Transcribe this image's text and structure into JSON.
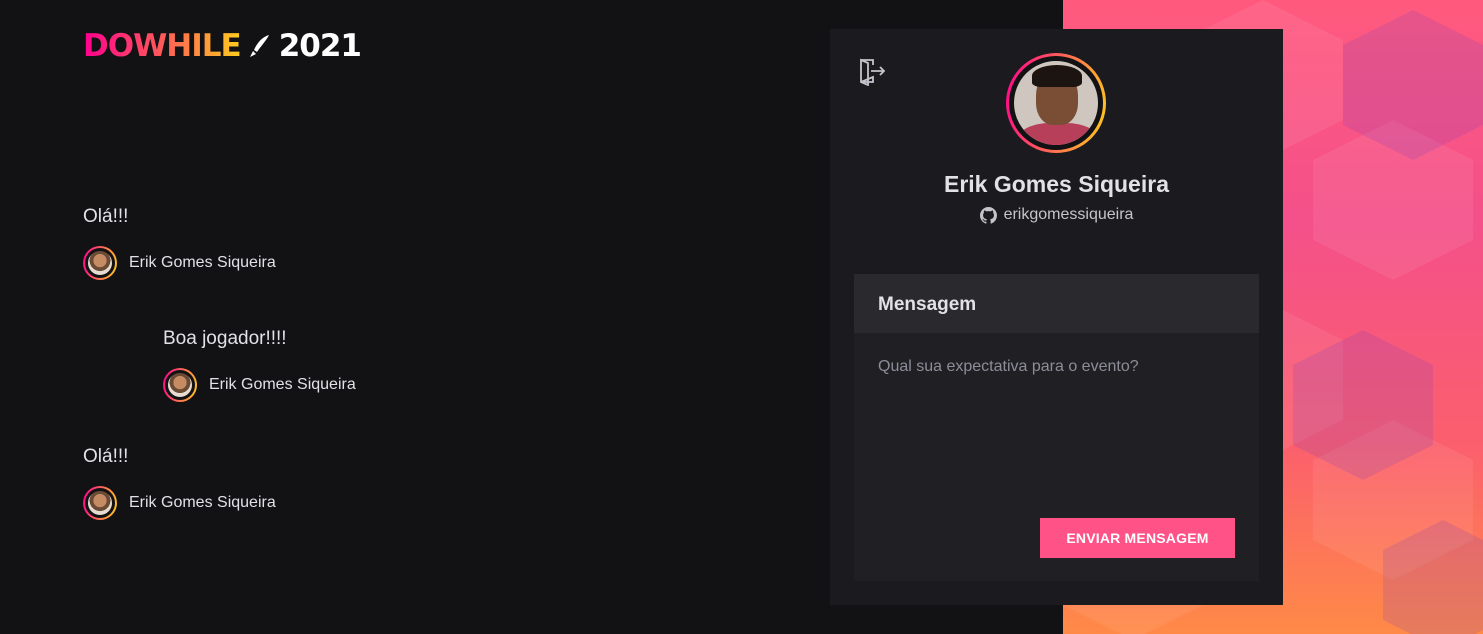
{
  "brand": {
    "logo_text": "DOWHILE",
    "logo_year": "2021"
  },
  "messages": [
    {
      "text": "Olá!!!",
      "user": "Erik Gomes Siqueira"
    },
    {
      "text": "Boa jogador!!!!",
      "user": "Erik Gomes Siqueira"
    },
    {
      "text": "Olá!!!",
      "user": "Erik Gomes Siqueira"
    }
  ],
  "profile": {
    "name": "Erik Gomes Siqueira",
    "github_username": "erikgomessiqueira"
  },
  "form": {
    "title": "Mensagem",
    "placeholder": "Qual sua expectativa para o evento?",
    "value": "",
    "submit_label": "ENVIAR MENSAGEM"
  },
  "icons": {
    "signout": "sign-out-icon",
    "github": "github-icon",
    "rocket": "rocket-icon"
  },
  "colors": {
    "background": "#121214",
    "card": "#1b1b1f",
    "accent": "#ff5286",
    "gradient_start": "#ff008e",
    "gradient_end": "#ffcd1e"
  }
}
